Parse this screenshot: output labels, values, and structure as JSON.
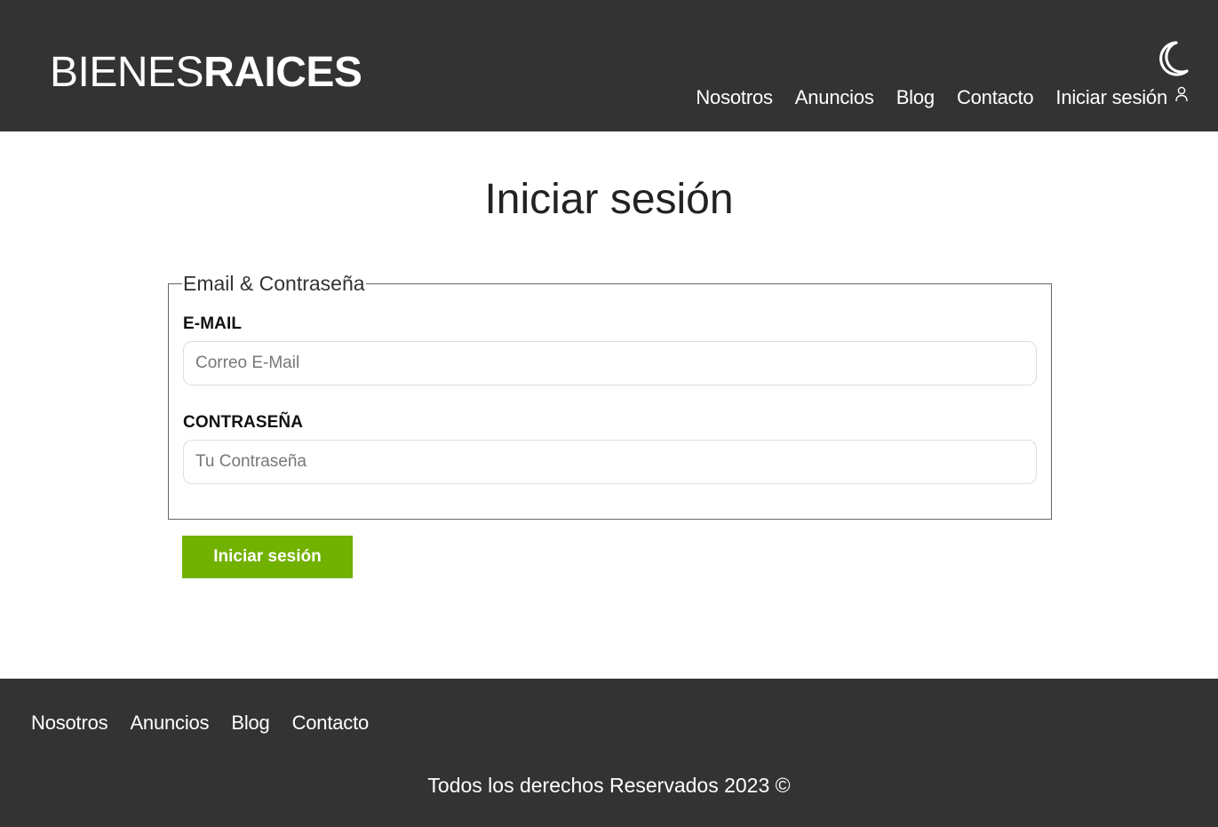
{
  "header": {
    "logo_light": "BIENES",
    "logo_bold": "RAICES",
    "theme_icon": "moon-icon",
    "nav": [
      {
        "label": "Nosotros"
      },
      {
        "label": "Anuncios"
      },
      {
        "label": "Blog"
      },
      {
        "label": "Contacto"
      },
      {
        "label": "Iniciar sesión",
        "icon": "user-icon"
      }
    ]
  },
  "main": {
    "title": "Iniciar sesión",
    "fieldset_legend": "Email & Contraseña",
    "email": {
      "label": "E-MAIL",
      "placeholder": "Correo E-Mail",
      "value": ""
    },
    "password": {
      "label": "CONTRASEÑA",
      "placeholder": "Tu Contraseña",
      "value": ""
    },
    "submit_label": "Iniciar sesión",
    "submit_color": "#71b100"
  },
  "footer": {
    "nav": [
      {
        "label": "Nosotros"
      },
      {
        "label": "Anuncios"
      },
      {
        "label": "Blog"
      },
      {
        "label": "Contacto"
      }
    ],
    "copyright": "Todos los derechos Reservados 2023 ©"
  },
  "colors": {
    "header_bg": "#333333",
    "footer_bg": "#333333",
    "accent": "#71b100"
  }
}
